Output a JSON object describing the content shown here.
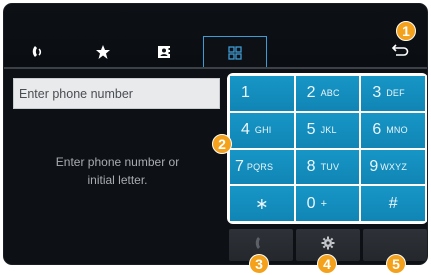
{
  "tabs": [
    {
      "icon": "recent-calls-icon"
    },
    {
      "icon": "favorites-star-icon"
    },
    {
      "icon": "contacts-icon"
    },
    {
      "icon": "dial-pad-icon",
      "active": true
    }
  ],
  "back": {
    "icon": "back-arrow-icon"
  },
  "input": {
    "placeholder": "Enter phone number"
  },
  "hint": {
    "line1": "Enter phone number or",
    "line2": "initial letter."
  },
  "keypad": {
    "keys": [
      {
        "digit": "1",
        "letters": ""
      },
      {
        "digit": "2",
        "letters": "ABC"
      },
      {
        "digit": "3",
        "letters": "DEF"
      },
      {
        "digit": "4",
        "letters": "GHI"
      },
      {
        "digit": "5",
        "letters": "JKL"
      },
      {
        "digit": "6",
        "letters": "MNO"
      },
      {
        "digit": "7",
        "letters": "PQRS"
      },
      {
        "digit": "8",
        "letters": "TUV"
      },
      {
        "digit": "9",
        "letters": "WXYZ"
      },
      {
        "digit": "∗",
        "letters": ""
      },
      {
        "digit": "0",
        "letters": "+"
      },
      {
        "digit": "#",
        "letters": ""
      }
    ]
  },
  "bottom": {
    "call": {
      "icon": "call-handset-icon"
    },
    "settings": {
      "icon": "gear-icon"
    },
    "delete": {
      "icon": ""
    }
  },
  "callouts": [
    "1",
    "2",
    "3",
    "4",
    "5"
  ],
  "colors": {
    "accent": "#1796c6",
    "badge": "#f4a11c",
    "background": "#0d1014"
  }
}
